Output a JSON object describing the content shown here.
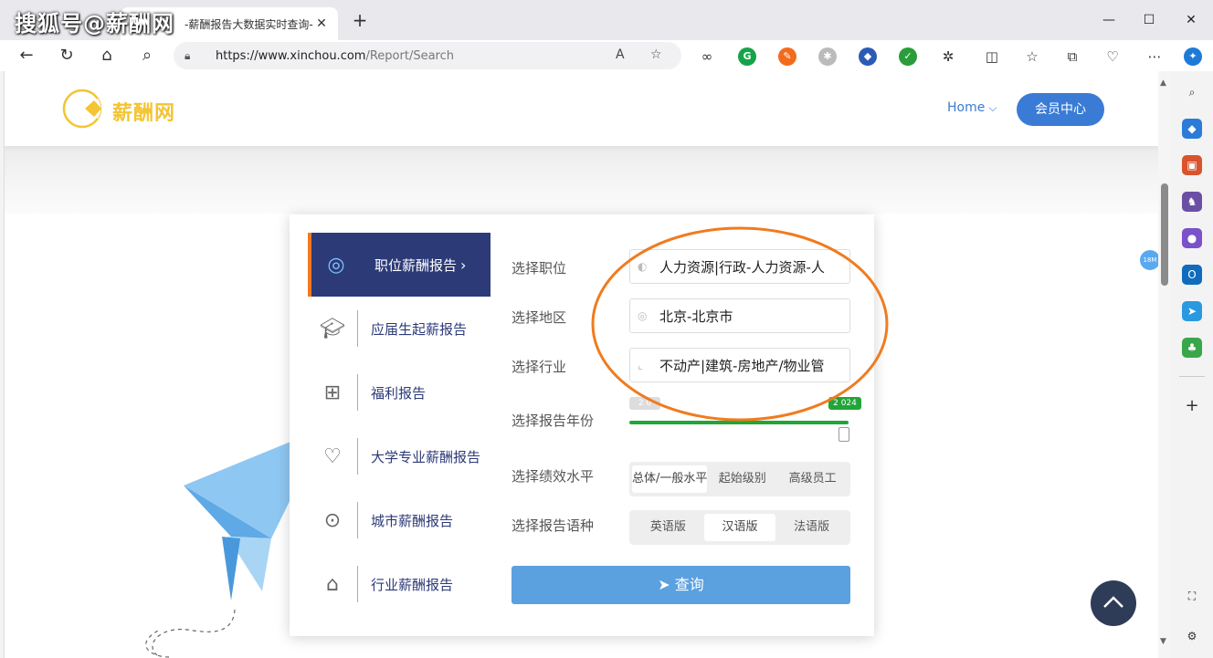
{
  "watermark": "搜狐号@薪酬网",
  "tab": {
    "title": "-薪酬报告大数据实时查询-"
  },
  "address": {
    "host": "https://www.xinchou.com",
    "path": "/Report/Search"
  },
  "site": {
    "logo_text": "薪酬网",
    "nav_home": "Home",
    "member_center": "会员中心"
  },
  "menu": {
    "items": [
      {
        "label": "职位薪酬报告",
        "icon": "globe-icon",
        "active": true
      },
      {
        "label": "应届生起薪报告",
        "icon": "graduation-cap-icon",
        "active": false
      },
      {
        "label": "福利报告",
        "icon": "gift-icon",
        "active": false
      },
      {
        "label": "大学专业薪酬报告",
        "icon": "book-heart-icon",
        "active": false
      },
      {
        "label": "城市薪酬报告",
        "icon": "target-icon",
        "active": false
      },
      {
        "label": "行业薪酬报告",
        "icon": "factory-icon",
        "active": false
      }
    ]
  },
  "form": {
    "position": {
      "label": "选择职位",
      "value": "人力资源|行政-人力资源-人"
    },
    "region": {
      "label": "选择地区",
      "value": "北京-北京市"
    },
    "industry": {
      "label": "选择行业",
      "value": "不动产|建筑-房地产/物业管"
    },
    "year": {
      "label": "选择报告年份",
      "min_label": "2 0",
      "max_label": "2 024",
      "fill_fraction": 1.0
    },
    "performance": {
      "label": "选择绩效水平",
      "options": [
        "总体/一般水平",
        "起始级别",
        "高级员工"
      ],
      "selected": 0
    },
    "language": {
      "label": "选择报告语种",
      "options": [
        "英语版",
        "汉语版",
        "法语版"
      ],
      "selected": 1
    },
    "query_button": "查询"
  },
  "badge": "18M",
  "colors": {
    "accent": "#3a7bd5",
    "menu_active": "#2c3a78",
    "menu_marker": "#f07b1f",
    "slider": "#21a537",
    "query": "#5ba0df",
    "annotation": "#f07b1f"
  }
}
